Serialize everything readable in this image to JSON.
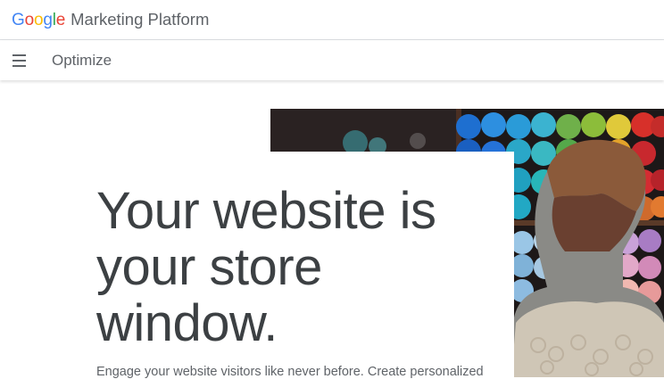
{
  "header": {
    "logo_letters": [
      {
        "ch": "G",
        "color": "#4285F4"
      },
      {
        "ch": "o",
        "color": "#EA4335"
      },
      {
        "ch": "o",
        "color": "#FBBC05"
      },
      {
        "ch": "g",
        "color": "#4285F4"
      },
      {
        "ch": "l",
        "color": "#34A853"
      },
      {
        "ch": "e",
        "color": "#EA4335"
      }
    ],
    "logo_text": "Google",
    "product_name": "Marketing Platform"
  },
  "subheader": {
    "menu_icon": "hamburger-menu-icon",
    "title": "Optimize"
  },
  "hero": {
    "headline": "Your website is your store window.",
    "body": "Engage your website visitors like never before. Create personalized",
    "image": "woman-browsing-yarn-shelves-photo"
  }
}
